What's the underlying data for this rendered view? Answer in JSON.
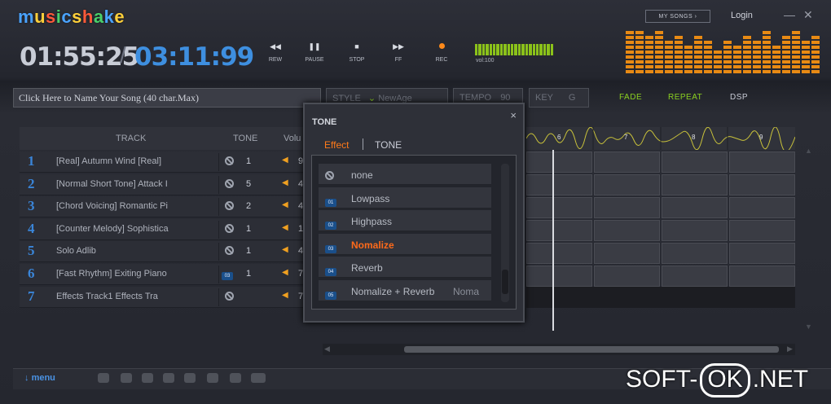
{
  "app": {
    "logo_letters": [
      {
        "ch": "m",
        "color": "#4aa3ff"
      },
      {
        "ch": "u",
        "color": "#ffd03a"
      },
      {
        "ch": "s",
        "color": "#ff5a3a"
      },
      {
        "ch": "i",
        "color": "#4ad06a"
      },
      {
        "ch": "c",
        "color": "#4aa3ff"
      },
      {
        "ch": "s",
        "color": "#ffd03a"
      },
      {
        "ch": "h",
        "color": "#ff5a3a"
      },
      {
        "ch": "a",
        "color": "#4ad06a"
      },
      {
        "ch": "k",
        "color": "#4aa3ff"
      },
      {
        "ch": "e",
        "color": "#ffd03a"
      }
    ],
    "my_songs": "MY SONGS",
    "login": "Login",
    "minimize": "—",
    "close": "✕"
  },
  "transport": {
    "current_time": "01:55:25",
    "separator": "/",
    "total_time": "03:11:99",
    "buttons": [
      {
        "icon": "rewind-icon",
        "glyph": "◀◀",
        "label": "REW"
      },
      {
        "icon": "pause-icon",
        "glyph": "❚❚",
        "label": "PAUSE"
      },
      {
        "icon": "stop-icon",
        "glyph": "■",
        "label": "STOP"
      },
      {
        "icon": "fast-forward-icon",
        "glyph": "▶▶",
        "label": "FF"
      },
      {
        "icon": "record-icon",
        "glyph": "",
        "label": "REC"
      }
    ],
    "volume_label": "vol:100",
    "volume_level": 1.0
  },
  "song": {
    "name_placeholder": "Click Here to Name Your Song (40 char.Max)",
    "style_label": "STYLE",
    "style_value": "NewAge",
    "tempo_label": "TEMPO",
    "tempo_value": "90",
    "key_label": "KEY",
    "key_value": "G",
    "fade": "FADE",
    "repeat": "REPEAT",
    "dsp": "DSP",
    "accent_green": "#8bd020"
  },
  "tracks": {
    "headers": {
      "track": "TRACK",
      "tone": "TONE",
      "volume": "Volu"
    },
    "rows": [
      {
        "num": "1",
        "name": "[Real] Autumn Wind    [Real]",
        "tone": "1",
        "vol": "9"
      },
      {
        "num": "2",
        "name": "[Normal Short Tone] Attack I",
        "tone": "5",
        "vol": "4"
      },
      {
        "num": "3",
        "name": "[Chord Voicing] Romantic Pi",
        "tone": "2",
        "vol": "4"
      },
      {
        "num": "4",
        "name": "[Counter Melody] Sophistica",
        "tone": "1",
        "vol": "1"
      },
      {
        "num": "5",
        "name": "Solo Adlib",
        "tone": "1",
        "vol": "4"
      },
      {
        "num": "6",
        "name": "[Fast Rhythm] Exiting Piano",
        "tone": "1",
        "vol": "7"
      },
      {
        "num": "7",
        "name": "Effects Track1    Effects Tra",
        "tone": "",
        "vol": "7"
      }
    ]
  },
  "timeline": {
    "bars": [
      "6",
      "7",
      "8",
      "9"
    ]
  },
  "popup": {
    "title": "TONE",
    "close": "×",
    "tabs": [
      {
        "label": "Effect",
        "active": true
      },
      {
        "label": "TONE",
        "active": false
      }
    ],
    "items": [
      {
        "label": "none",
        "badge": "",
        "selected": false,
        "extra": ""
      },
      {
        "label": "Lowpass",
        "badge": "01",
        "selected": false,
        "extra": ""
      },
      {
        "label": "Highpass",
        "badge": "02",
        "selected": false,
        "extra": ""
      },
      {
        "label": "Nomalize",
        "badge": "03",
        "selected": true,
        "extra": ""
      },
      {
        "label": "Reverb",
        "badge": "04",
        "selected": false,
        "extra": ""
      },
      {
        "label": "Nomalize + Reverb",
        "badge": "05",
        "selected": false,
        "extra": "Noma"
      }
    ]
  },
  "bottom": {
    "menu": "menu"
  },
  "watermark": {
    "left": "SOFT-",
    "ok": "OK",
    "right": ".NET"
  }
}
